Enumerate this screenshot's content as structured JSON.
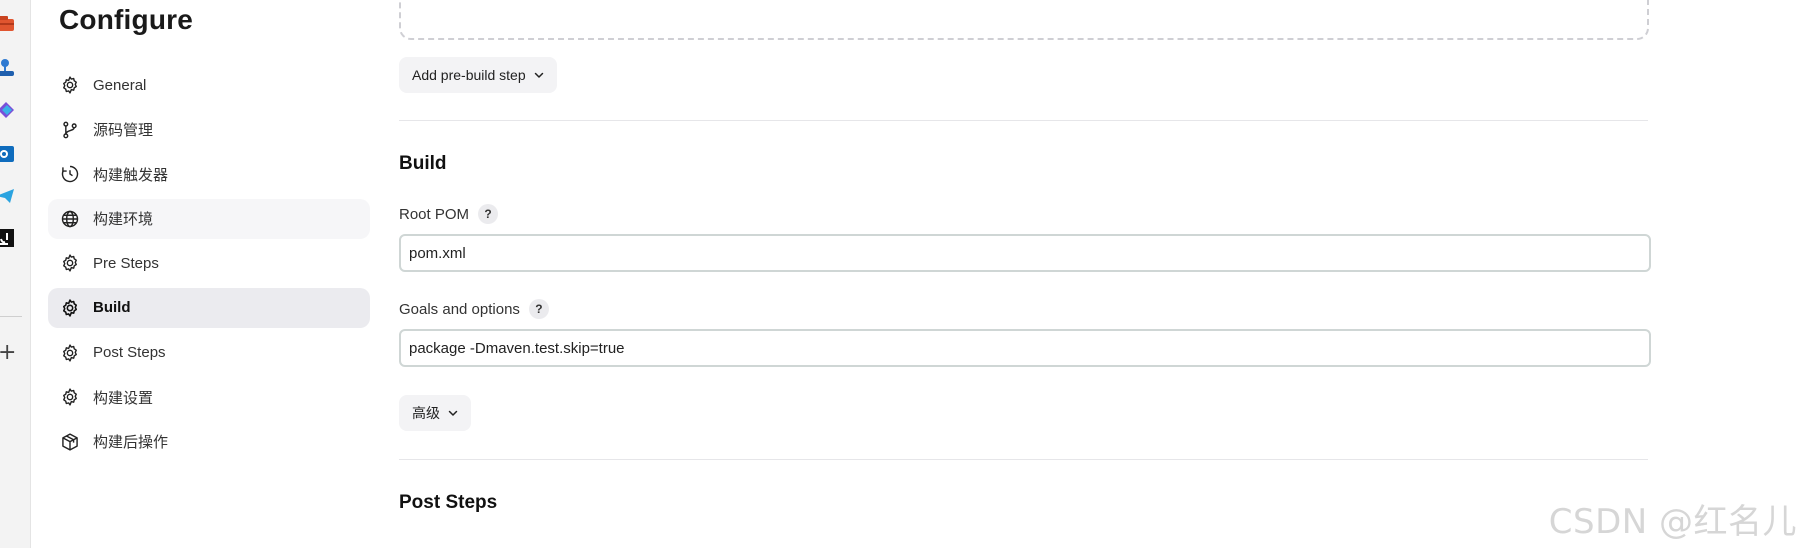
{
  "page": {
    "title": "Configure"
  },
  "sidebar": {
    "items": [
      {
        "label": "General",
        "icon": "gear-icon"
      },
      {
        "label": "源码管理",
        "icon": "branch-icon"
      },
      {
        "label": "构建触发器",
        "icon": "clock-icon"
      },
      {
        "label": "构建环境",
        "icon": "globe-icon"
      },
      {
        "label": "Pre Steps",
        "icon": "gear-icon"
      },
      {
        "label": "Build",
        "icon": "gear-icon",
        "active": true
      },
      {
        "label": "Post Steps",
        "icon": "gear-icon"
      },
      {
        "label": "构建设置",
        "icon": "gear-icon"
      },
      {
        "label": "构建后操作",
        "icon": "package-icon"
      }
    ]
  },
  "pre_steps": {
    "add_button_label": "Add pre-build step"
  },
  "build": {
    "title": "Build",
    "root_pom": {
      "label": "Root POM",
      "help": "?",
      "value": "pom.xml"
    },
    "goals": {
      "label": "Goals and options",
      "help": "?",
      "value": "package -Dmaven.test.skip=true"
    },
    "advanced_label": "高级"
  },
  "post_steps": {
    "title": "Post Steps"
  },
  "watermark": "CSDN @红名儿",
  "colors": {
    "active_bg": "#ebebef",
    "hover_bg": "#f6f6f8",
    "input_border": "#cfd6d5",
    "divider": "#e6e6e9"
  }
}
